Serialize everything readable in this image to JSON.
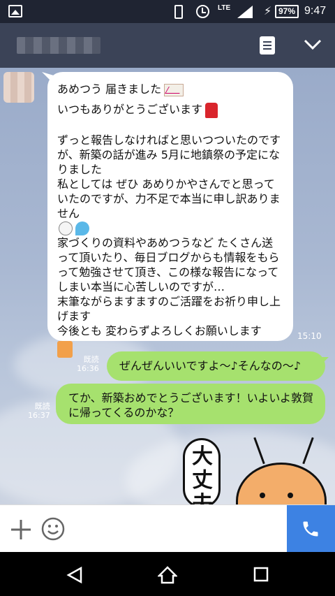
{
  "status_bar": {
    "network": "LTE",
    "battery": "97%",
    "time": "9:47",
    "icons": [
      "gallery-icon",
      "vibrate-icon",
      "alarm-icon",
      "signal-icon",
      "charging-icon"
    ]
  },
  "header": {
    "icons": [
      "notes-icon",
      "chevron-down-icon"
    ]
  },
  "messages": [
    {
      "direction": "incoming",
      "lines": [
        "あめつう 届きました",
        "いつもありがとうございます",
        "",
        "ずっと報告しなければと思いつついたのですが、新築の話が進み 5月に地鎮祭の予定になりました",
        "私としては ぜひ あめりかやさんでと思っていたのですが、力不足で本当に申し訳ありません",
        "家づくりの資料やあめつうなど たくさん送って頂いたり、毎日ブログからも情報をもらって勉強させて頂き、この様な報告になってしまい本当に心苦しいのですが…",
        "末筆ながらますますのご活躍をお祈り申し上げます",
        "今後とも 変わらずよろしくお願いします"
      ],
      "time": "15:10"
    },
    {
      "direction": "outgoing",
      "text": "ぜんぜんいいですよ～♪そんなの～♪",
      "read": "既読",
      "time": "16:36"
    },
    {
      "direction": "outgoing",
      "text": "てか、新築おめでとうございます！いよいよ敦賀に帰ってくるのかな？",
      "read": "既読",
      "time": "16:37"
    }
  ],
  "sticker": {
    "text": "大丈夫"
  },
  "input_bar": {
    "icons": [
      "plus-icon",
      "smile-icon",
      "phone-icon"
    ]
  },
  "nav_bar": {
    "icons": [
      "back-icon",
      "home-icon",
      "recents-icon"
    ]
  },
  "colors": {
    "header": "#3b4357",
    "status_bar": "#1f2432",
    "outgoing_bubble": "#a6e16e",
    "incoming_bubble": "#ffffff",
    "call_button": "#3d82e3"
  }
}
